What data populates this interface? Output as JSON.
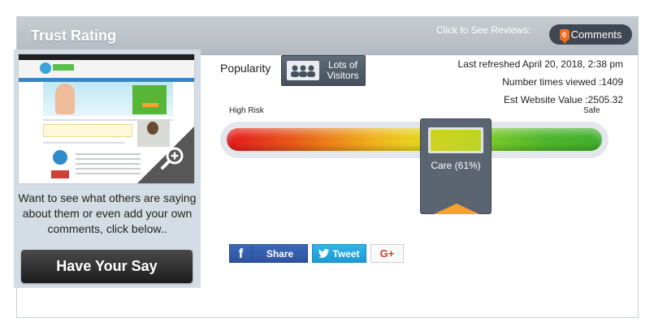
{
  "header": {
    "title": "Trust Rating",
    "reviews_label": "Click to See Reviews:",
    "comments_count": "0",
    "comments_label": "Comments"
  },
  "left_panel": {
    "preview_icon": "zoom-in-icon",
    "prompt_text": "Want to see what others are saying about them or even add your own comments, click below..",
    "cta_label": "Have Your Say"
  },
  "popularity": {
    "label": "Popularity",
    "badge_icon": "people-icon",
    "badge_text": "Lots of Visitors"
  },
  "stats": {
    "last_refreshed": "Last refreshed April 20, 2018, 2:38 pm",
    "times_viewed": "Number times viewed :1409",
    "website_value": "Est Website Value :2505.32"
  },
  "gauge": {
    "low_label": "High Risk",
    "high_label": "Safe",
    "rating_label": "Care (61%)",
    "rating_percent": 61,
    "colors": {
      "low": "#e4191b",
      "mid": "#e7d21d",
      "high": "#3fae2b",
      "marker": "#5b6572",
      "pointer": "#f2a52a"
    }
  },
  "social": {
    "facebook_icon": "facebook-icon",
    "facebook_label": "Share",
    "twitter_icon": "twitter-icon",
    "twitter_label": "Tweet",
    "googleplus_label": "G+"
  },
  "colors": {
    "header_bg": "#b9c0c7",
    "panel_bg": "#d4dde5",
    "dark_button": "#2b2b2b",
    "accent_orange": "#f26b1d"
  }
}
